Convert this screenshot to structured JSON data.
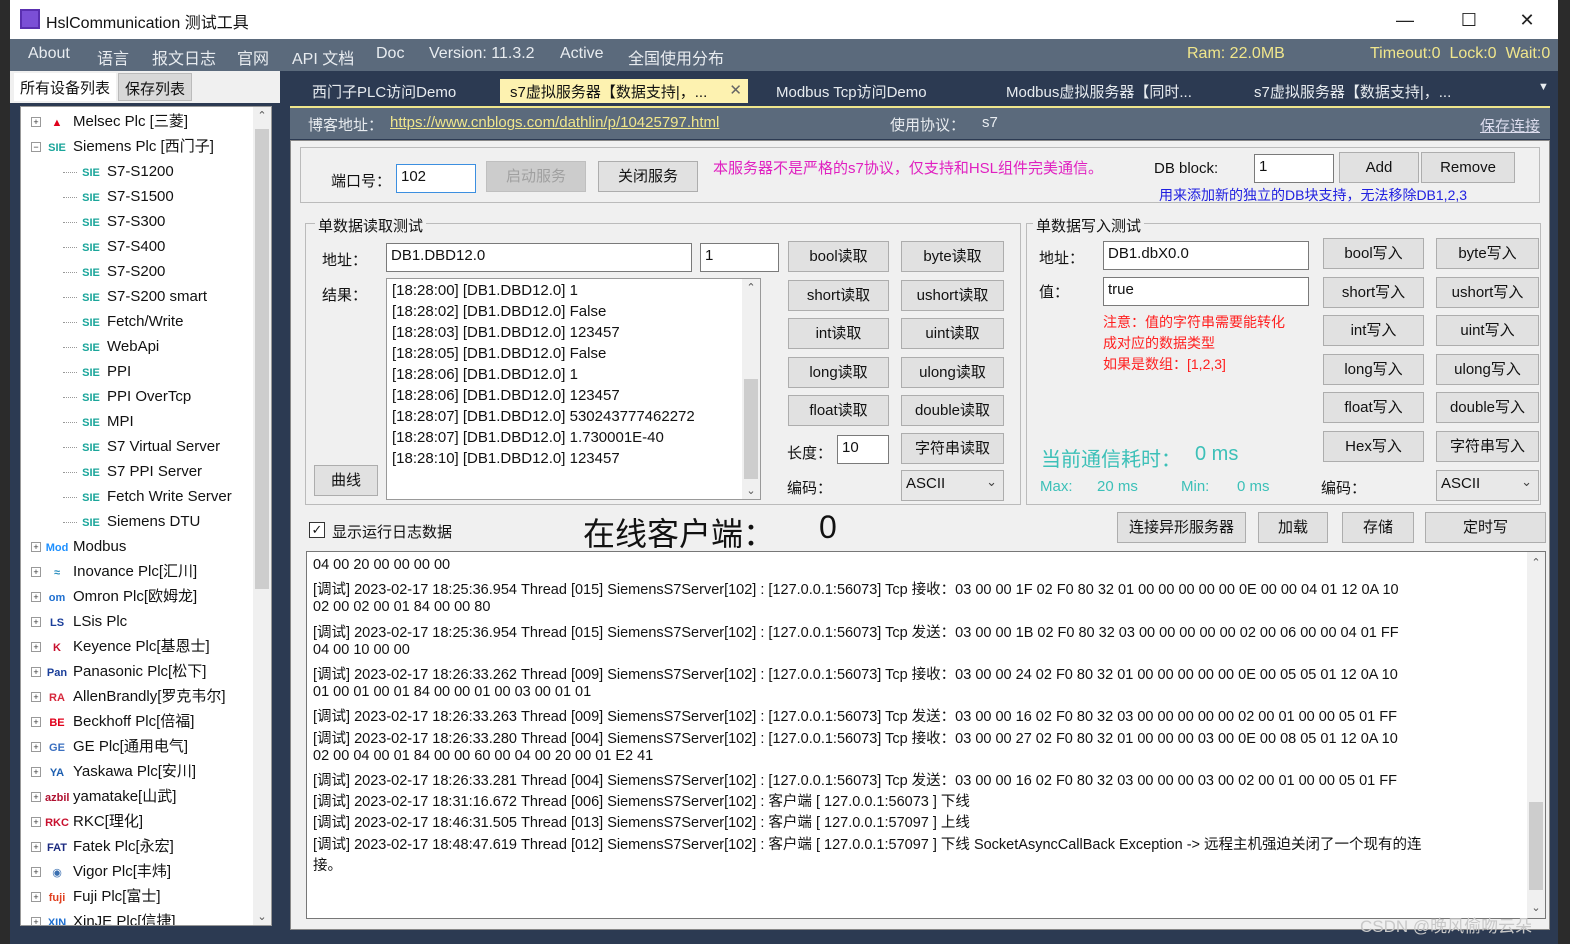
{
  "window": {
    "title": "HslCommunication 测试工具",
    "minimize": "—",
    "maximize": "☐",
    "close": "✕"
  },
  "menu": {
    "items": [
      "About",
      "语言",
      "报文日志",
      "官网",
      "API 文档",
      "Doc",
      "Version: 11.3.2",
      "Active",
      "全国使用分布"
    ],
    "ram": "Ram: 22.0MB",
    "status": "Timeout:0  Lock:0  Wait:0"
  },
  "left_tabs": [
    "所有设备列表",
    "保存列表"
  ],
  "tree": [
    {
      "label": "Melsec Plc [三菱]",
      "icon": "SIE",
      "icon_name": "mitsubishi-icon",
      "level": 0,
      "exp": "+"
    },
    {
      "label": "Siemens Plc [西门子]",
      "icon": "SIE",
      "icon_name": "siemens-icon",
      "level": 0,
      "exp": "−"
    },
    {
      "label": "S7-S1200",
      "level": 1
    },
    {
      "label": "S7-S1500",
      "level": 1
    },
    {
      "label": "S7-S300",
      "level": 1
    },
    {
      "label": "S7-S400",
      "level": 1
    },
    {
      "label": "S7-S200",
      "level": 1
    },
    {
      "label": "S7-S200 smart",
      "level": 1
    },
    {
      "label": "Fetch/Write",
      "level": 1
    },
    {
      "label": "WebApi",
      "level": 1
    },
    {
      "label": "PPI",
      "level": 1
    },
    {
      "label": "PPI OverTcp",
      "level": 1
    },
    {
      "label": "MPI",
      "level": 1
    },
    {
      "label": "S7 Virtual Server",
      "level": 1
    },
    {
      "label": "S7 PPI Server",
      "level": 1
    },
    {
      "label": "Fetch Write Server",
      "level": 1
    },
    {
      "label": "Siemens DTU",
      "level": 1
    },
    {
      "label": "Modbus",
      "level": 0,
      "exp": "+"
    },
    {
      "label": "Inovance Plc[汇川]",
      "level": 0,
      "exp": "+"
    },
    {
      "label": "Omron Plc[欧姆龙]",
      "level": 0,
      "exp": "+"
    },
    {
      "label": "LSis Plc",
      "level": 0,
      "exp": "+"
    },
    {
      "label": "Keyence Plc[基恩士]",
      "level": 0,
      "exp": "+"
    },
    {
      "label": "Panasonic Plc[松下]",
      "level": 0,
      "exp": "+"
    },
    {
      "label": "AllenBrandly[罗克韦尔]",
      "level": 0,
      "exp": "+"
    },
    {
      "label": "Beckhoff Plc[倍福]",
      "level": 0,
      "exp": "+"
    },
    {
      "label": "GE Plc[通用电气]",
      "level": 0,
      "exp": "+"
    },
    {
      "label": "Yaskawa Plc[安川]",
      "level": 0,
      "exp": "+"
    },
    {
      "label": "yamatake[山武]",
      "level": 0,
      "exp": "+"
    },
    {
      "label": "RKC[理化]",
      "level": 0,
      "exp": "+"
    },
    {
      "label": "Fatek Plc[永宏]",
      "level": 0,
      "exp": "+"
    },
    {
      "label": "Vigor Plc[丰炜]",
      "level": 0,
      "exp": "+"
    },
    {
      "label": "Fuji Plc[富士]",
      "level": 0,
      "exp": "+"
    },
    {
      "label": "XinJE Plc[信捷]",
      "level": 0,
      "exp": "+"
    }
  ],
  "tree_icons": [
    "▲",
    "SIE",
    "SIE",
    "SIE",
    "SIE",
    "SIE",
    "SIE",
    "SIE",
    "SIE",
    "SIE",
    "SIE",
    "SIE",
    "SIE",
    "SIE",
    "SIE",
    "SIE",
    "SIE",
    "Mod",
    "≈",
    "om",
    "LS",
    "K",
    "Pan",
    "RA",
    "BE",
    "GE",
    "YA",
    "azbil",
    "RKC",
    "FAT",
    "◉",
    "fuji",
    "XIN"
  ],
  "tree_icon_colors": [
    "#e0001b",
    "#1aa59a",
    "#1aa59a",
    "#1aa59a",
    "#1aa59a",
    "#1aa59a",
    "#1aa59a",
    "#1aa59a",
    "#1aa59a",
    "#1aa59a",
    "#1aa59a",
    "#1aa59a",
    "#1aa59a",
    "#1aa59a",
    "#1aa59a",
    "#1aa59a",
    "#1aa59a",
    "#1e90ff",
    "#2a8fbf",
    "#1e6fd0",
    "#1b3f9a",
    "#c8102e",
    "#1b3f9a",
    "#d6283c",
    "#e0001b",
    "#3a6fc0",
    "#1e5fb0",
    "#b01030",
    "#c8102e",
    "#1b2a80",
    "#3a6fb0",
    "#e04020",
    "#1e6fd0"
  ],
  "tabs": [
    "西门子PLC访问Demo",
    "s7虚拟服务器【数据支持|，...",
    "Modbus Tcp访问Demo",
    "Modbus虚拟服务器【同时...",
    "s7虚拟服务器【数据支持|，..."
  ],
  "tab_close": "✕",
  "tab_menu": "▼",
  "blog": {
    "label": "博客地址：",
    "url": "https://www.cnblogs.com/dathlin/p/10425797.html",
    "protocol_label": "使用协议：",
    "protocol": "s7",
    "save_link": "保存连接"
  },
  "server": {
    "port_label": "端口号：",
    "port": "102",
    "start": "启动服务",
    "stop": "关闭服务",
    "notice": "本服务器不是严格的s7协议，仅支持和HSL组件完美通信。",
    "db_label": "DB block:",
    "db_value": "1",
    "add": "Add",
    "remove": "Remove",
    "db_hint": "用来添加新的独立的DB块支持，无法移除DB1,2,3"
  },
  "read": {
    "title": "单数据读取测试",
    "addr_label": "地址：",
    "address": "DB1.DBD12.0",
    "count": "1",
    "result_label": "结果：",
    "curve": "曲线",
    "results": [
      "[18:28:00] [DB1.DBD12.0] 1",
      "[18:28:02] [DB1.DBD12.0] False",
      "[18:28:03] [DB1.DBD12.0] 123457",
      "[18:28:05] [DB1.DBD12.0] False",
      "[18:28:06] [DB1.DBD12.0] 1",
      "[18:28:06] [DB1.DBD12.0] 123457",
      "[18:28:07] [DB1.DBD12.0] 530243777462272",
      "[18:28:07] [DB1.DBD12.0] 1.730001E-40",
      "[18:28:10] [DB1.DBD12.0] 123457"
    ],
    "buttons": [
      "bool读取",
      "byte读取",
      "short读取",
      "ushort读取",
      "int读取",
      "uint读取",
      "long读取",
      "ulong读取",
      "float读取",
      "double读取"
    ],
    "length_label": "长度：",
    "length": "10",
    "string_read": "字符串读取",
    "encoding_label": "编码：",
    "encoding": "ASCII"
  },
  "write": {
    "title": "单数据写入测试",
    "addr_label": "地址：",
    "address": "DB1.dbX0.0",
    "value_label": "值：",
    "value": "true",
    "notes": [
      "注意：值的字符串需要能转化",
      "成对应的数据类型",
      "如果是数组：[1,2,3]"
    ],
    "buttons": [
      "bool写入",
      "byte写入",
      "short写入",
      "ushort写入",
      "int写入",
      "uint写入",
      "long写入",
      "ulong写入",
      "float写入",
      "double写入",
      "Hex写入",
      "字符串写入"
    ],
    "time_label": "当前通信耗时：",
    "time": "0 ms",
    "max_label": "Max:",
    "max": "20 ms",
    "min_label": "Min:",
    "min": "0 ms",
    "encoding_label": "编码：",
    "encoding": "ASCII"
  },
  "footer": {
    "show_log": "显示运行日志数据",
    "show_log_checked": true,
    "online_label": "在线客户端：",
    "online_count": "0",
    "buttons": [
      "连接异形服务器",
      "加载",
      "存储",
      "定时写"
    ]
  },
  "log": [
    "04 00 20 00 00 00 00",
    "[调试] 2023-02-17 18:25:36.954 Thread [015] SiemensS7Server[102] : [127.0.0.1:56073] Tcp 接收：03 00 00 1F 02 F0 80 32 01 00 00 00 00 00 0E 00 00 04 01 12 0A 10",
    "02 00 02 00 01 84 00 00 80",
    "[调试] 2023-02-17 18:25:36.954 Thread [015] SiemensS7Server[102] : [127.0.0.1:56073] Tcp 发送：03 00 00 1B 02 F0 80 32 03 00 00 00 00 00 02 00 06 00 00 04 01 FF",
    "04 00 10 00 00",
    "[调试] 2023-02-17 18:26:33.262 Thread [009] SiemensS7Server[102] : [127.0.0.1:56073] Tcp 接收：03 00 00 24 02 F0 80 32 01 00 00 00 00 00 0E 00 05 05 01 12 0A 10",
    "01 00 01 00 01 84 00 00 01 00 03 00 01 01",
    "[调试] 2023-02-17 18:26:33.263 Thread [009] SiemensS7Server[102] : [127.0.0.1:56073] Tcp 发送：03 00 00 16 02 F0 80 32 03 00 00 00 00 00 02 00 01 00 00 05 01 FF",
    "[调试] 2023-02-17 18:26:33.280 Thread [004] SiemensS7Server[102] : [127.0.0.1:56073] Tcp 接收：03 00 00 27 02 F0 80 32 01 00 00 00 03 00 0E 00 08 05 01 12 0A 10",
    "02 00 04 00 01 84 00 00 60 00 04 00 20 00 01 E2 41",
    "[调试] 2023-02-17 18:26:33.281 Thread [004] SiemensS7Server[102] : [127.0.0.1:56073] Tcp 发送：03 00 00 16 02 F0 80 32 03 00 00 00 03 00 02 00 01 00 00 05 01 FF",
    "[调试] 2023-02-17 18:31:16.672 Thread [006] SiemensS7Server[102] : 客户端 [ 127.0.0.1:56073 ] 下线",
    "[调试] 2023-02-17 18:46:31.505 Thread [013] SiemensS7Server[102] : 客户端 [ 127.0.0.1:57097 ] 上线",
    "[调试] 2023-02-17 18:48:47.619 Thread [012] SiemensS7Server[102] : 客户端 [ 127.0.0.1:57097 ] 下线 SocketAsyncCallBack Exception -> 远程主机强迫关闭了一个现有的连",
    "接。"
  ],
  "watermark": "CSDN @晚风偷吻云朵",
  "colors": {
    "menubar": "#5b6a7c",
    "tabbar": "#2c3a52",
    "active_tab": "#fdf2b0",
    "notice": "#e020c0",
    "hint": "#2020e0",
    "note_red": "#ff2020",
    "time_teal": "#3cc0b8"
  }
}
